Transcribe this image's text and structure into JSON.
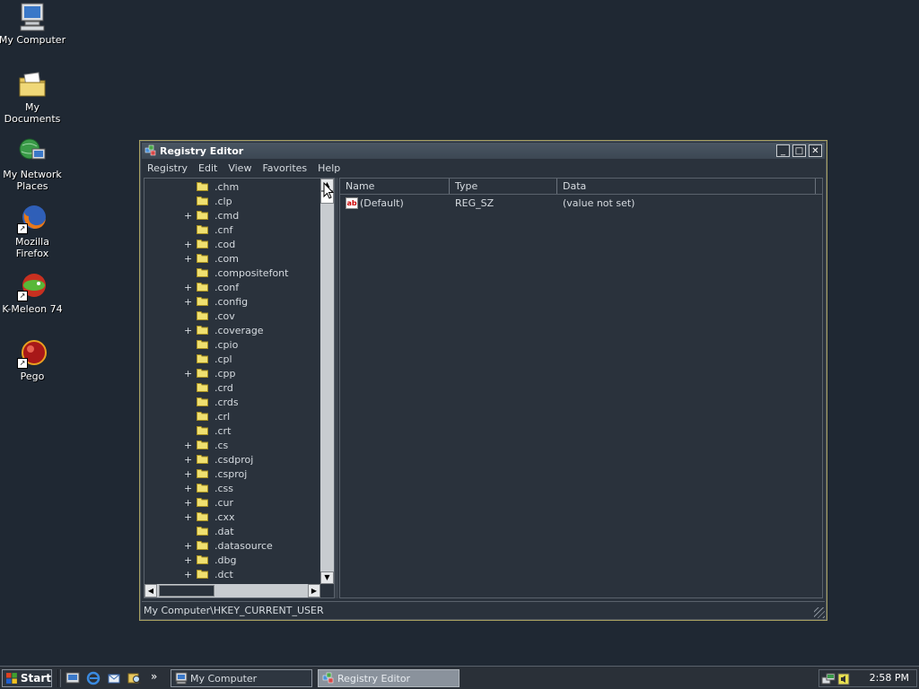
{
  "desktop": {
    "icons": [
      {
        "label": "My Computer"
      },
      {
        "label": "My Documents"
      },
      {
        "label": "My Network Places"
      },
      {
        "label": "Mozilla Firefox"
      },
      {
        "label": "K-Meleon 74"
      },
      {
        "label": "Pego"
      }
    ]
  },
  "window": {
    "title": "Registry Editor",
    "buttons": {
      "minimize": "_",
      "maximize": "□",
      "close": "✕"
    },
    "menu": [
      "Registry",
      "Edit",
      "View",
      "Favorites",
      "Help"
    ],
    "tree": [
      {
        "name": ".chm",
        "expander": ""
      },
      {
        "name": ".clp",
        "expander": ""
      },
      {
        "name": ".cmd",
        "expander": "+"
      },
      {
        "name": ".cnf",
        "expander": ""
      },
      {
        "name": ".cod",
        "expander": "+"
      },
      {
        "name": ".com",
        "expander": "+"
      },
      {
        "name": ".compositefont",
        "expander": ""
      },
      {
        "name": ".conf",
        "expander": "+"
      },
      {
        "name": ".config",
        "expander": "+"
      },
      {
        "name": ".cov",
        "expander": ""
      },
      {
        "name": ".coverage",
        "expander": "+"
      },
      {
        "name": ".cpio",
        "expander": ""
      },
      {
        "name": ".cpl",
        "expander": ""
      },
      {
        "name": ".cpp",
        "expander": "+"
      },
      {
        "name": ".crd",
        "expander": ""
      },
      {
        "name": ".crds",
        "expander": ""
      },
      {
        "name": ".crl",
        "expander": ""
      },
      {
        "name": ".crt",
        "expander": ""
      },
      {
        "name": ".cs",
        "expander": "+"
      },
      {
        "name": ".csdproj",
        "expander": "+"
      },
      {
        "name": ".csproj",
        "expander": "+"
      },
      {
        "name": ".css",
        "expander": "+"
      },
      {
        "name": ".cur",
        "expander": "+"
      },
      {
        "name": ".cxx",
        "expander": "+"
      },
      {
        "name": ".dat",
        "expander": ""
      },
      {
        "name": ".datasource",
        "expander": "+"
      },
      {
        "name": ".dbg",
        "expander": "+"
      },
      {
        "name": ".dct",
        "expander": "+"
      }
    ],
    "list": {
      "columns": [
        "Name",
        "Type",
        "Data"
      ],
      "rows": [
        {
          "name": "(Default)",
          "type": "REG_SZ",
          "data": "(value not set)"
        }
      ]
    },
    "status": "My Computer\\HKEY_CURRENT_USER"
  },
  "taskbar": {
    "start_label": "Start",
    "more": "»",
    "tasks": [
      {
        "label": "My Computer"
      },
      {
        "label": "Registry Editor"
      }
    ],
    "clock": "2:58 PM"
  }
}
